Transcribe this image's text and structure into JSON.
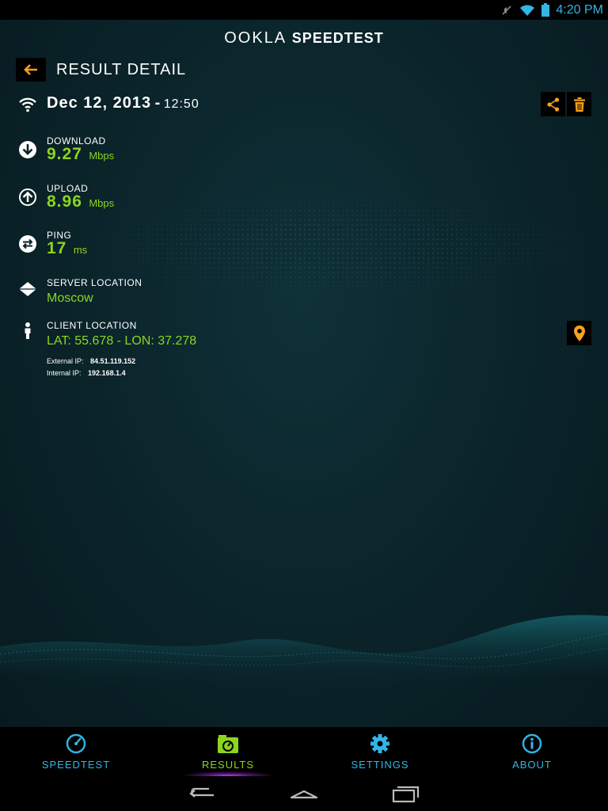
{
  "status_bar": {
    "time": "4:20 PM",
    "icons": [
      "mute-icon",
      "wifi-icon",
      "battery-icon"
    ]
  },
  "header": {
    "brand": "OOKLA",
    "product": "SPEEDTEST"
  },
  "page": {
    "title": "RESULT DETAIL",
    "back_icon": "arrow-left-icon"
  },
  "result": {
    "date": "Dec 12, 2013",
    "separator": "-",
    "time": "12:50",
    "connection_icon": "wifi-icon",
    "actions": {
      "share_icon": "share-icon",
      "delete_icon": "trash-icon"
    }
  },
  "download": {
    "label": "DOWNLOAD",
    "value": "9.27",
    "unit": "Mbps",
    "icon": "download-arrow-icon"
  },
  "upload": {
    "label": "UPLOAD",
    "value": "8.96",
    "unit": "Mbps",
    "icon": "upload-arrow-icon"
  },
  "ping": {
    "label": "PING",
    "value": "17",
    "unit": "ms",
    "icon": "ping-icon"
  },
  "server": {
    "label": "SERVER LOCATION",
    "value": "Moscow",
    "icon": "server-icon"
  },
  "client": {
    "label": "CLIENT LOCATION",
    "value": "LAT: 55.678 - LON: 37.278",
    "icon": "person-icon",
    "map_icon": "map-pin-icon",
    "external_ip_label": "External IP:",
    "external_ip": "84.51.119.152",
    "internal_ip_label": "Internal IP:",
    "internal_ip": "192.168.1.4"
  },
  "nav": {
    "tabs": [
      {
        "label": "SPEEDTEST",
        "icon": "speedometer-icon",
        "active": false
      },
      {
        "label": "RESULTS",
        "icon": "results-icon",
        "active": true
      },
      {
        "label": "SETTINGS",
        "icon": "gear-icon",
        "active": false
      },
      {
        "label": "ABOUT",
        "icon": "info-icon",
        "active": false
      }
    ]
  },
  "colors": {
    "accent_green": "#8cd51f",
    "accent_orange": "#f7a21b",
    "accent_blue": "#33b5e5",
    "background": "#0a2329"
  }
}
